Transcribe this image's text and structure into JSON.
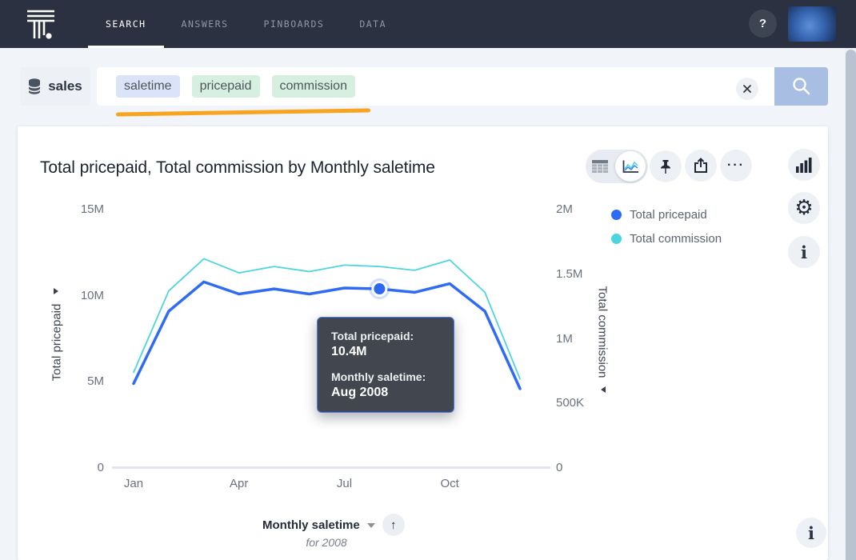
{
  "nav": {
    "tabs": [
      {
        "label": "SEARCH",
        "active": true
      },
      {
        "label": "ANSWERS",
        "active": false
      },
      {
        "label": "PINBOARDS",
        "active": false
      },
      {
        "label": "DATA",
        "active": false
      }
    ],
    "help_label": "?"
  },
  "search": {
    "source_label": "sales",
    "tokens": [
      {
        "text": "saletime",
        "color": "#dae3f8"
      },
      {
        "text": "pricepaid",
        "color": "#d7efe1"
      },
      {
        "text": "commission",
        "color": "#d7efe1"
      }
    ]
  },
  "answer": {
    "title": "Total pricepaid, Total commission by Monthly saletime",
    "tooltip": {
      "metric_label": "Total pricepaid:",
      "metric_value": "10.4M",
      "dim_label": "Monthly saletime:",
      "dim_value": "Aug 2008"
    },
    "x_axis_label": "Monthly saletime",
    "x_axis_filter": "for 2008",
    "more_label": "···",
    "up_arrow": "↑",
    "gear_glyph": "⚙",
    "info_glyph": "i"
  },
  "chart_data": {
    "type": "line",
    "title": "Total pricepaid, Total commission by Monthly saletime",
    "x": [
      "Jan 2008",
      "Feb 2008",
      "Mar 2008",
      "Apr 2008",
      "May 2008",
      "Jun 2008",
      "Jul 2008",
      "Aug 2008",
      "Sep 2008",
      "Oct 2008",
      "Nov 2008",
      "Dec 2008"
    ],
    "x_tick_labels": [
      {
        "label": "Jan",
        "index": 0
      },
      {
        "label": "Apr",
        "index": 3
      },
      {
        "label": "Jul",
        "index": 6
      },
      {
        "label": "Oct",
        "index": 9
      }
    ],
    "series": [
      {
        "name": "Total pricepaid",
        "axis": "left",
        "color": "#2f6bf3",
        "unit": "M",
        "values": [
          4.9,
          9.1,
          10.8,
          10.1,
          10.4,
          10.1,
          10.45,
          10.4,
          10.2,
          10.7,
          9.1,
          4.6
        ]
      },
      {
        "name": "Total commission",
        "axis": "right",
        "color": "#4cd5df",
        "unit": "M",
        "values": [
          0.74,
          1.37,
          1.62,
          1.51,
          1.56,
          1.52,
          1.57,
          1.56,
          1.53,
          1.61,
          1.36,
          0.69
        ]
      }
    ],
    "left_axis": {
      "title": "Total pricepaid",
      "max": 15,
      "min": 0,
      "ticks": [
        {
          "label": "15M",
          "value": 15
        },
        {
          "label": "10M",
          "value": 10
        },
        {
          "label": "5M",
          "value": 5
        },
        {
          "label": "0",
          "value": 0
        }
      ]
    },
    "right_axis": {
      "title": "Total commission",
      "max": 2,
      "min": 0,
      "ticks": [
        {
          "label": "2M",
          "value": 2
        },
        {
          "label": "1.5M",
          "value": 1.5
        },
        {
          "label": "1M",
          "value": 1
        },
        {
          "label": "500K",
          "value": 0.5
        },
        {
          "label": "0",
          "value": 0
        }
      ]
    },
    "highlighted_point": {
      "series": "Total pricepaid",
      "x": "Aug 2008",
      "value_label": "10.4M"
    },
    "legend": [
      {
        "label": "Total pricepaid",
        "color": "#2f6bf3"
      },
      {
        "label": "Total commission",
        "color": "#4cd5df"
      }
    ],
    "grid": false,
    "legend_position": "right"
  }
}
